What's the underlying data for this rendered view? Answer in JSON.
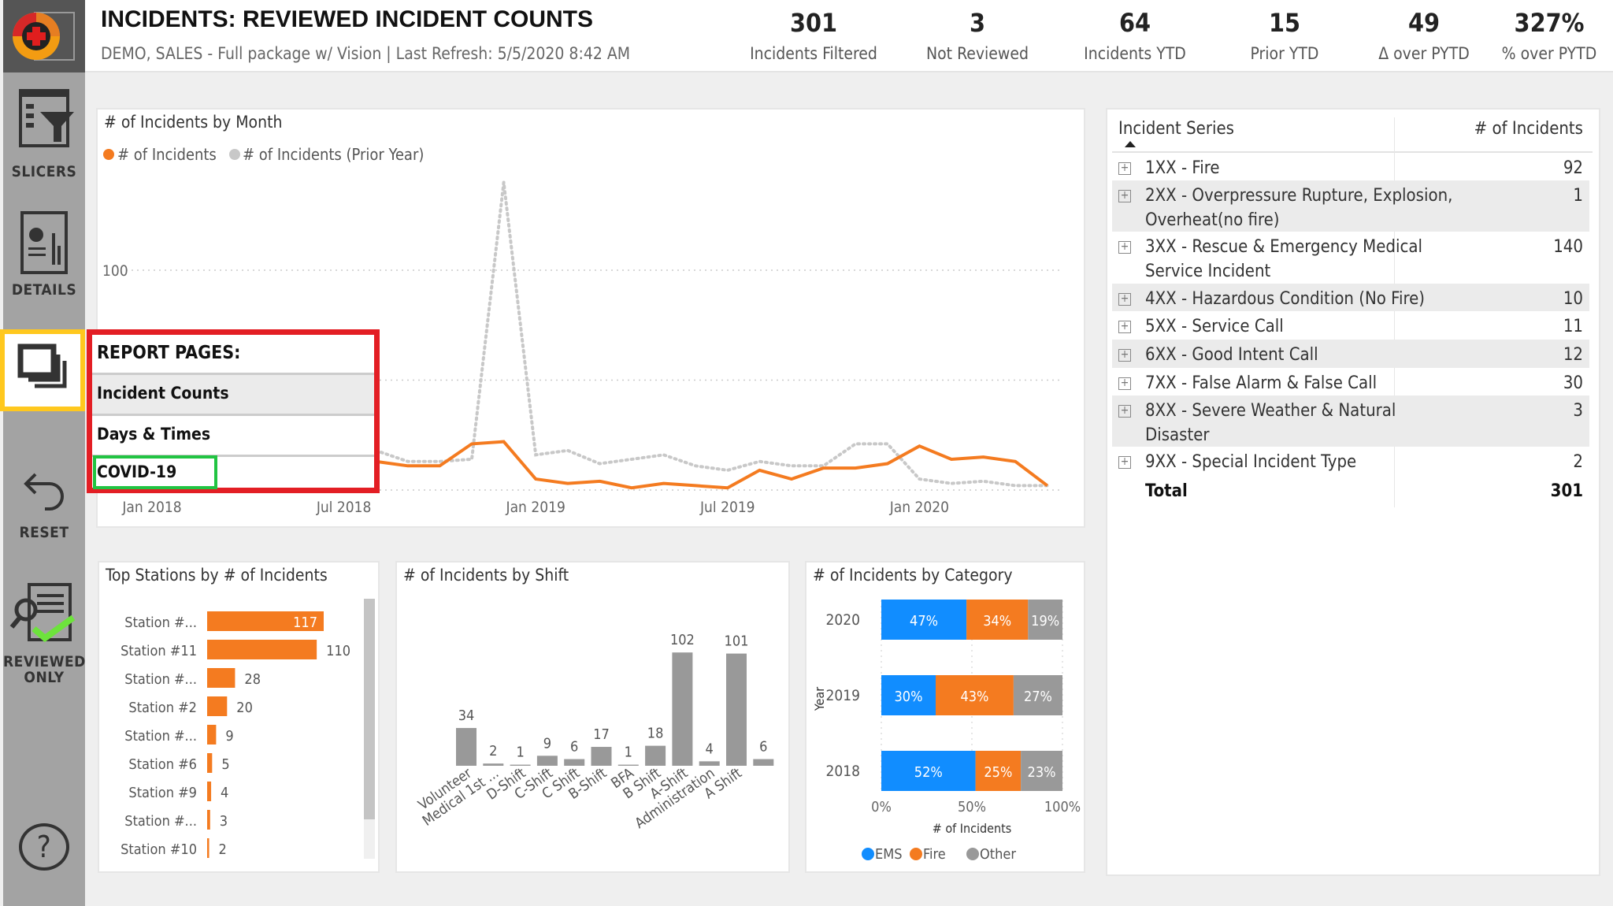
{
  "header": {
    "title": "INCIDENTS: REVIEWED INCIDENT COUNTS",
    "subtitle": "DEMO, SALES - Full package w/ Vision | Last Refresh: 5/5/2020 8:42 AM"
  },
  "kpis": [
    {
      "value": "301",
      "label": "Incidents Filtered"
    },
    {
      "value": "3",
      "label": "Not Reviewed"
    },
    {
      "value": "64",
      "label": "Incidents YTD"
    },
    {
      "value": "15",
      "label": "Prior YTD"
    },
    {
      "value": "49",
      "label": "Δ over PYTD"
    },
    {
      "value": "327%",
      "label": "% over PYTD"
    }
  ],
  "sidebar": {
    "slicers": "SLICERS",
    "details": "DETAILS",
    "reset": "RESET",
    "reviewed": "REVIEWED",
    "only": "ONLY",
    "help": "?"
  },
  "report_pages": {
    "title": "REPORT PAGES:",
    "items": [
      "Incident Counts",
      "Days & Times",
      "COVID-19"
    ],
    "active": "Incident Counts",
    "highlighted": "COVID-19"
  },
  "colors": {
    "accent": "#f47b20",
    "ems": "#118dff",
    "fire": "#f47b20",
    "other": "#999999",
    "prior": "#c8c8c8",
    "highlight": "#ffc81e",
    "popup_border": "#e31e24",
    "green": "#21c442"
  },
  "chart_data": [
    {
      "type": "line",
      "title": "# of Incidents by Month",
      "ytick_labels": [
        "100"
      ],
      "ylim": [
        0,
        145
      ],
      "grid": true,
      "legend": "top-left",
      "xtick_labels": [
        "Jan 2018",
        "Jul 2018",
        "Jan 2019",
        "Jul 2019",
        "Jan 2020"
      ],
      "x": [
        "Jan 2018",
        "Feb 2018",
        "Mar 2018",
        "Apr 2018",
        "May 2018",
        "Jun 2018",
        "Jul 2018",
        "Aug 2018",
        "Sep 2018",
        "Oct 2018",
        "Nov 2018",
        "Dec 2018",
        "Jan 2019",
        "Feb 2019",
        "Mar 2019",
        "Apr 2019",
        "May 2019",
        "Jun 2019",
        "Jul 2019",
        "Aug 2019",
        "Sep 2019",
        "Oct 2019",
        "Nov 2019",
        "Dec 2019",
        "Jan 2020",
        "Feb 2020",
        "Mar 2020",
        "Apr 2020",
        "May 2020"
      ],
      "series": [
        {
          "name": "# of Incidents",
          "values": [
            null,
            null,
            null,
            null,
            null,
            null,
            null,
            13,
            11,
            11,
            21,
            22,
            5,
            3,
            4,
            1,
            3,
            2,
            1,
            9,
            5,
            10,
            10,
            12,
            20,
            14,
            15,
            13,
            2
          ]
        },
        {
          "name": "# of Incidents (Prior Year)",
          "values": [
            null,
            null,
            null,
            null,
            null,
            null,
            null,
            18,
            13,
            13,
            14,
            140,
            16,
            18,
            12,
            14,
            16,
            11,
            9,
            13,
            11,
            11,
            21,
            21,
            5,
            3,
            4,
            2,
            2
          ]
        }
      ]
    },
    {
      "type": "bar",
      "orientation": "horizontal",
      "title": "Top Stations by # of Incidents",
      "categories": [
        "Station #...",
        "Station #11",
        "Station #...",
        "Station #2",
        "Station #...",
        "Station #6",
        "Station #9",
        "Station #...",
        "Station #10"
      ],
      "values": [
        117,
        110,
        28,
        20,
        9,
        5,
        4,
        3,
        2
      ]
    },
    {
      "type": "bar",
      "title": "# of Incidents by Shift",
      "categories": [
        "Volunteer",
        "Medical 1st ...",
        "D-Shift",
        "C-Shift",
        "C Shift",
        "B-Shift",
        "BFA",
        "B Shift",
        "A-Shift",
        "Administration",
        "A Shift",
        ""
      ],
      "values": [
        34,
        2,
        1,
        9,
        6,
        17,
        1,
        18,
        102,
        4,
        101,
        6
      ]
    },
    {
      "type": "bar",
      "orientation": "horizontal",
      "stacked": "100%",
      "title": "# of Incidents by Category",
      "ylabel": "Year",
      "xlabel": "# of Incidents",
      "categories": [
        "2020",
        "2019",
        "2018"
      ],
      "xtick_labels": [
        "0%",
        "50%",
        "100%"
      ],
      "legend": "bottom",
      "series": [
        {
          "name": "EMS",
          "values": [
            47,
            30,
            52
          ]
        },
        {
          "name": "Fire",
          "values": [
            34,
            43,
            25
          ]
        },
        {
          "name": "Other",
          "values": [
            19,
            27,
            23
          ]
        }
      ]
    }
  ],
  "table": {
    "headers": [
      "Incident Series",
      "# of Incidents"
    ],
    "rows": [
      [
        "1XX - Fire",
        "92"
      ],
      [
        "2XX - Overpressure Rupture, Explosion, Overheat(no fire)",
        "1"
      ],
      [
        "3XX - Rescue & Emergency Medical Service Incident",
        "140"
      ],
      [
        "4XX - Hazardous Condition (No Fire)",
        "10"
      ],
      [
        "5XX - Service Call",
        "11"
      ],
      [
        "6XX - Good Intent Call",
        "12"
      ],
      [
        "7XX - False Alarm & False Call",
        "30"
      ],
      [
        "8XX - Severe Weather & Natural Disaster",
        "3"
      ],
      [
        "9XX - Special Incident Type",
        "2"
      ]
    ],
    "total_label": "Total",
    "total": "301"
  }
}
